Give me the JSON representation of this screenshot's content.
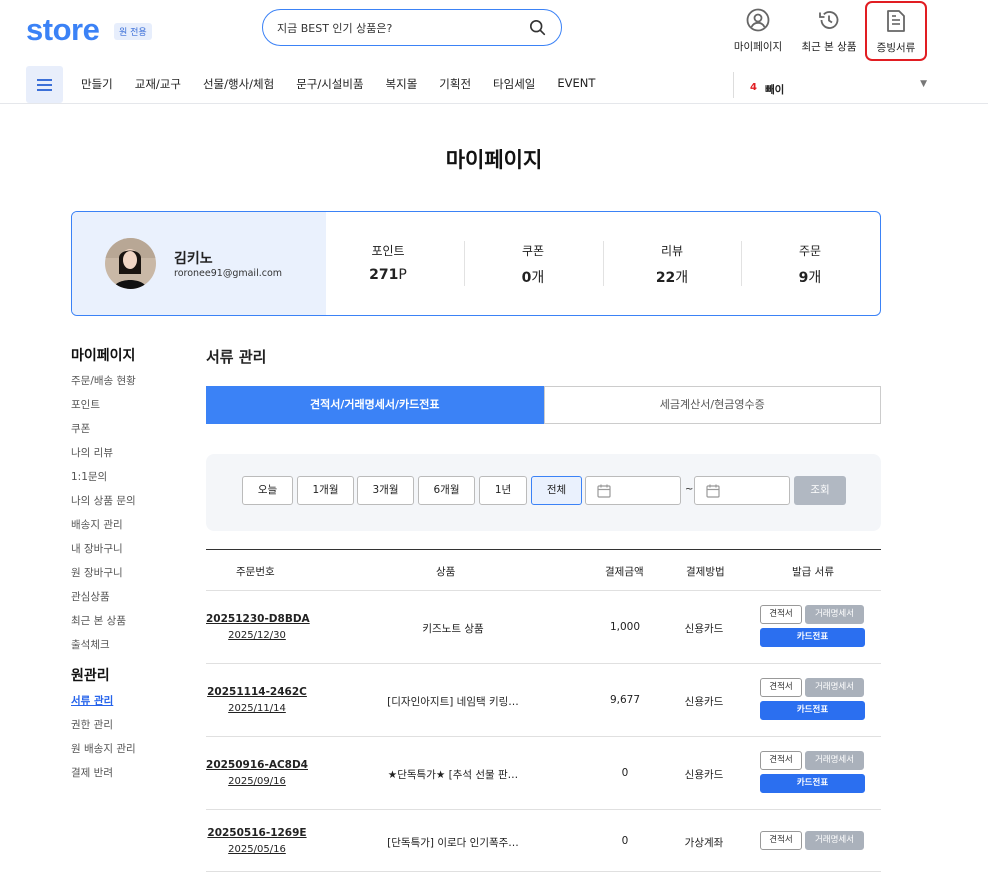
{
  "header": {
    "logo": "store",
    "logo_badge": "원 전용",
    "search_placeholder": "지금 BEST 인기 상품은?",
    "icons": [
      {
        "label": "마이페이지",
        "icon": "user-circle-icon"
      },
      {
        "label": "최근 본 상품",
        "icon": "history-icon"
      },
      {
        "label": "증빙서류",
        "icon": "document-icon"
      }
    ]
  },
  "nav": {
    "items": [
      "만들기",
      "교재/교구",
      "선물/행사/체험",
      "문구/시설비품",
      "복지몰",
      "기획전",
      "타임세일",
      "EVENT"
    ],
    "ticker_rank": "4",
    "ticker_word": "빼이"
  },
  "page_title": "마이페이지",
  "profile": {
    "name": "김키노",
    "email": "roronee91@gmail.com",
    "stats": [
      {
        "label": "포인트",
        "value": "271",
        "unit": "P"
      },
      {
        "label": "쿠폰",
        "value": "0",
        "unit": "개"
      },
      {
        "label": "리뷰",
        "value": "22",
        "unit": "개"
      },
      {
        "label": "주문",
        "value": "9",
        "unit": "개"
      }
    ]
  },
  "sidebar": {
    "heading1": "마이페이지",
    "items1": [
      "주문/배송 현황",
      "포인트",
      "쿠폰",
      "나의 리뷰",
      "1:1문의",
      "나의 상품 문의",
      "배송지 관리",
      "내 장바구니",
      "원 장바구니",
      "관심상품",
      "최근 본 상품",
      "출석체크"
    ],
    "heading2": "원관리",
    "items2": [
      "서류 관리",
      "권한 관리",
      "원 배송지 관리",
      "결제 반려"
    ],
    "active": "서류 관리"
  },
  "main": {
    "section_title": "서류 관리",
    "tabs": [
      "견적서/거래명세서/카드전표",
      "세금계산서/현금영수증"
    ],
    "active_tab": 0,
    "filter_buttons": [
      "오늘",
      "1개월",
      "3개월",
      "6개월",
      "1년",
      "전체"
    ],
    "active_filter": "전체",
    "date_separator": "~",
    "query_button": "조회",
    "table_headers": [
      "주문번호",
      "상품",
      "결제금액",
      "결제방법",
      "발급 서류"
    ],
    "doc_labels": {
      "estimate": "견적서",
      "statement": "거래명세서",
      "card": "카드전표"
    },
    "rows": [
      {
        "order_no": "20251230-D8BDA",
        "date": "2025/12/30",
        "product": "키즈노트 상품",
        "amount": "1,000",
        "payment": "신용카드",
        "card": true
      },
      {
        "order_no": "20251114-2462C",
        "date": "2025/11/14",
        "product": "[디자인아지트] 네임택 키링…",
        "amount": "9,677",
        "payment": "신용카드",
        "card": true
      },
      {
        "order_no": "20250916-AC8D4",
        "date": "2025/09/16",
        "product": "★단독특가★ [추석 선물 판…",
        "amount": "0",
        "payment": "신용카드",
        "card": true
      },
      {
        "order_no": "20250516-1269E",
        "date": "2025/05/16",
        "product": "[단독특가] 이로다 인기폭주…",
        "amount": "0",
        "payment": "가상계좌",
        "card": false
      }
    ]
  }
}
